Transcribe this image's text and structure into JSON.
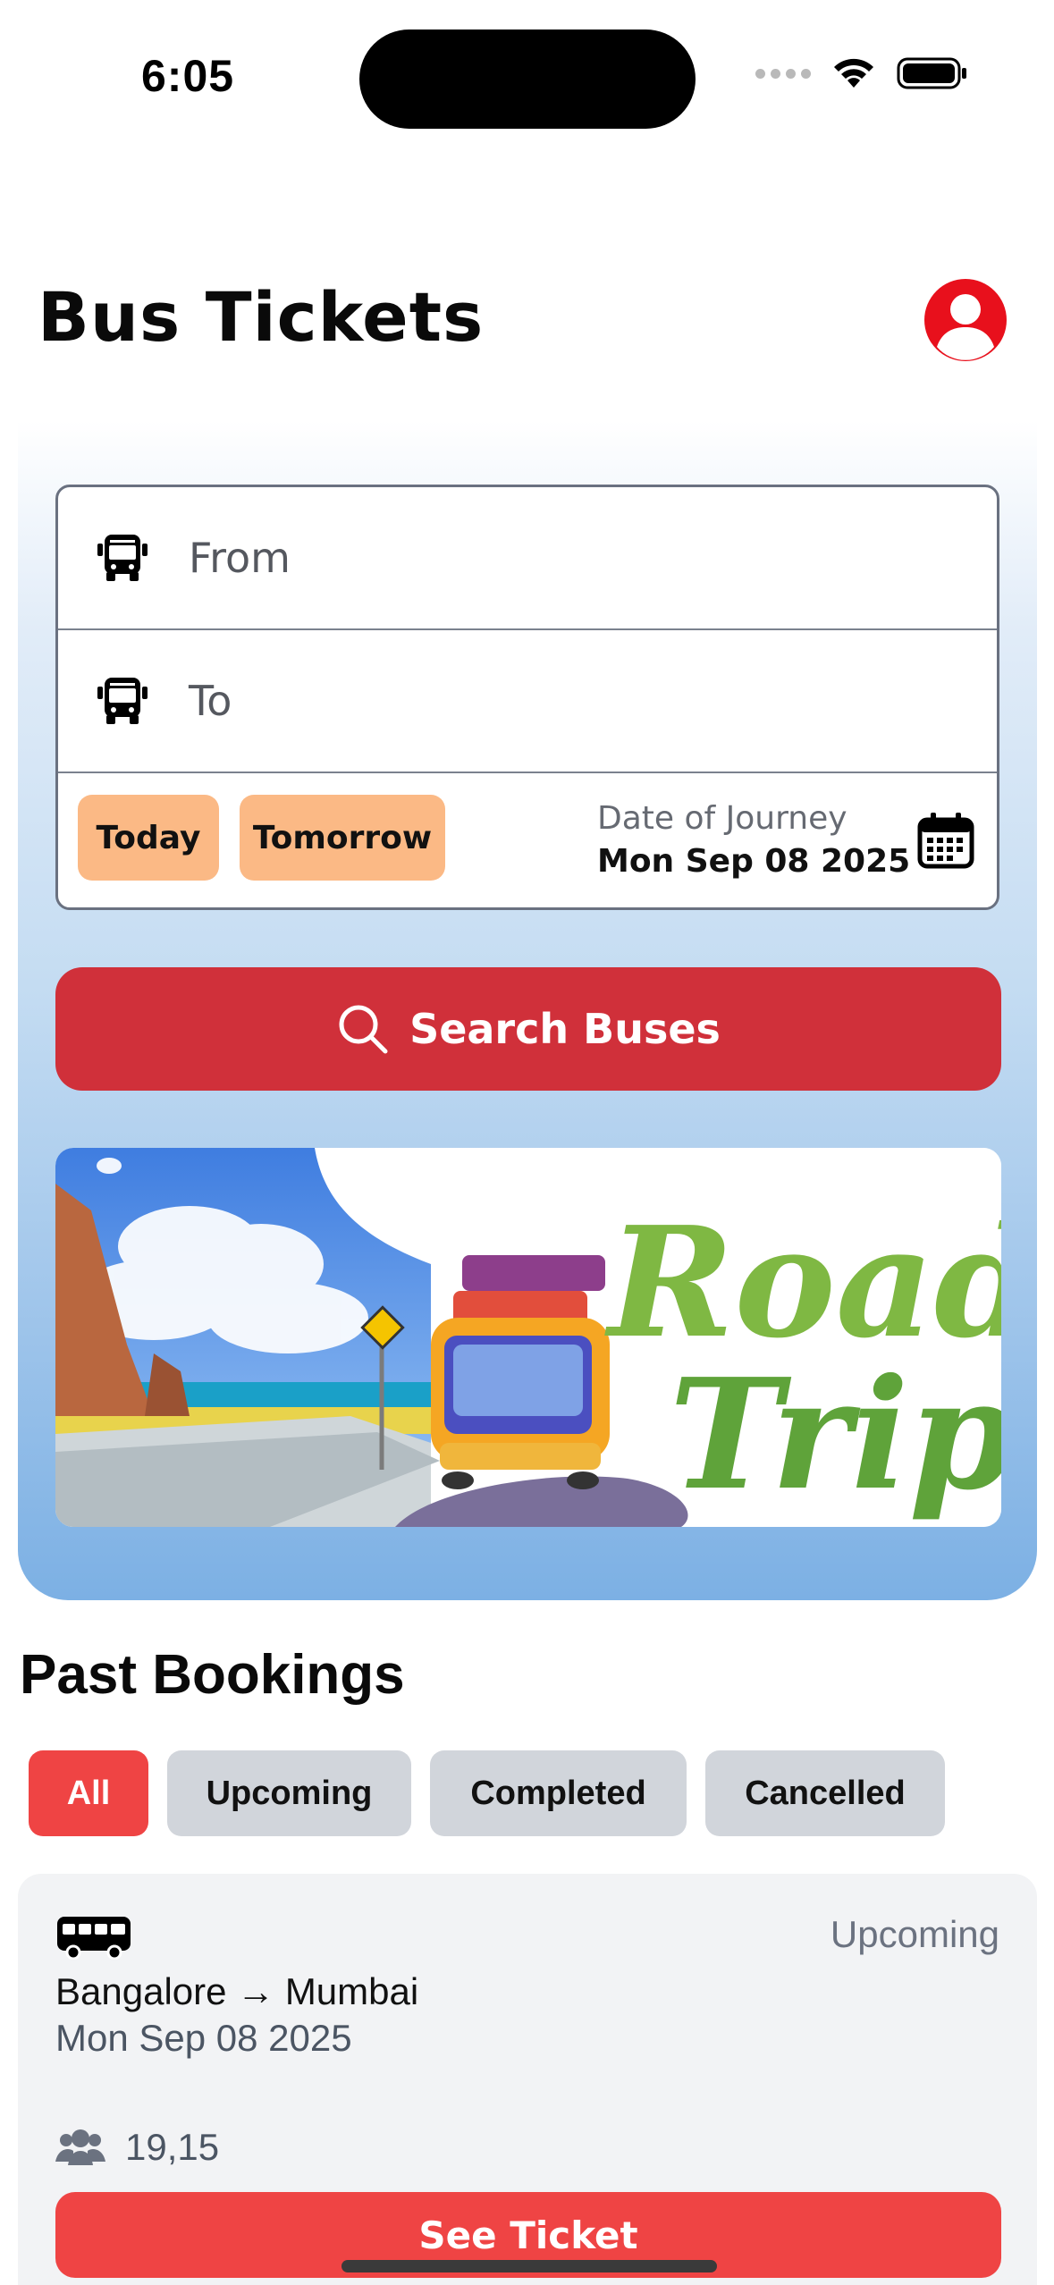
{
  "status_bar": {
    "time": "6:05"
  },
  "header": {
    "title": "Bus Tickets",
    "profile_icon": "user-circle-icon"
  },
  "search": {
    "from_placeholder": "From",
    "to_placeholder": "To",
    "quick_dates": [
      "Today",
      "Tomorrow"
    ],
    "date_label": "Date of Journey",
    "date_value": "Mon Sep 08 2025",
    "search_button": "Search Buses"
  },
  "banner": {
    "text": "Road Trip"
  },
  "past_bookings": {
    "title": "Past Bookings",
    "filters": [
      "All",
      "Upcoming",
      "Completed",
      "Cancelled"
    ],
    "active_filter": "All",
    "bookings": [
      {
        "status": "Upcoming",
        "route": "Bangalore → Mumbai",
        "date": "Mon Sep 08 2025",
        "seats": "19,15",
        "button": "See Ticket"
      }
    ]
  },
  "colors": {
    "accent_red": "#d0303a",
    "filter_active": "#ef4444",
    "chip_orange": "#fbb985",
    "profile_red": "#e8101c"
  }
}
